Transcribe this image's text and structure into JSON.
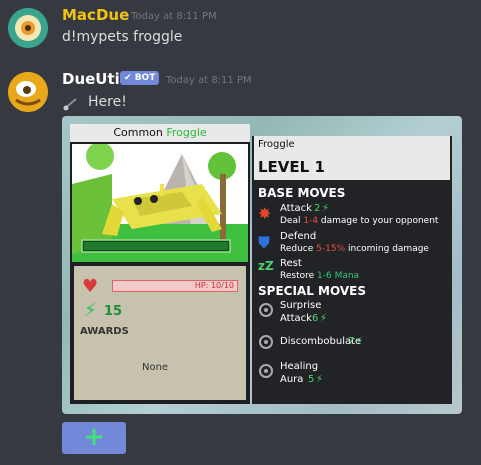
{
  "messages": [
    {
      "username": "MacDue",
      "username_color": "#f1c40f",
      "timestamp": "Today at 8:11 PM",
      "content": "d!mypets froggle"
    },
    {
      "username": "DueUtil",
      "username_color": "#ffffff",
      "bot_badge": "BOT",
      "timestamp": "Today at 8:11 PM",
      "content": "Here!",
      "embed": {
        "rarity": "Common",
        "pet_name": "Froggle",
        "level": "LEVEL 1",
        "hp_text": "HP: 10/10",
        "quest_count": "15",
        "awards_label": "AWARDS",
        "awards_value": "None",
        "base_moves_title": "BASE MOVES",
        "special_moves_title": "SPECIAL MOVES",
        "base_moves": [
          {
            "name": "Attack",
            "value": "2",
            "desc_pre": "Deal ",
            "desc_hl": "1-4",
            "desc_post": " damage to your opponent",
            "hl_color": "#e74c3c",
            "icon": "attack-icon"
          },
          {
            "name": "Defend",
            "value": "",
            "desc_pre": "Reduce ",
            "desc_hl": "5-15%",
            "desc_post": " incoming damage",
            "hl_color": "#e74c3c",
            "icon": "shield-icon"
          },
          {
            "name": "Rest",
            "value": "",
            "desc_pre": "Restore ",
            "desc_hl": "1-6 Mana",
            "desc_post": "",
            "hl_color": "#2ecc71",
            "icon": "rest-icon"
          }
        ],
        "special_moves": [
          {
            "name": "Surprise",
            "sub": "Attack",
            "value": "6"
          },
          {
            "name": "Discombobulate",
            "sub": "",
            "value": "7"
          },
          {
            "name": "Healing",
            "sub": "Aura",
            "value": "5"
          }
        ]
      }
    }
  ],
  "add_reaction_label": "+"
}
